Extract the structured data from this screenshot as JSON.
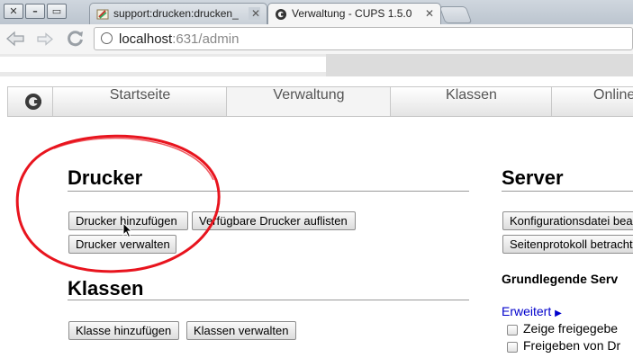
{
  "browser": {
    "tabs": [
      {
        "title": "support:drucken:drucken_",
        "active": false,
        "icon": "wiki-favicon-icon"
      },
      {
        "title": "Verwaltung - CUPS 1.5.0",
        "active": true,
        "icon": "cups-favicon-icon"
      }
    ],
    "close_glyph": "✕",
    "url_host": "localhost",
    "url_rest": ":631/admin",
    "window_buttons": {
      "minimize": "–",
      "restore": "▭"
    }
  },
  "cups": {
    "nav": [
      "Startseite",
      "Verwaltung",
      "Klassen",
      "Online"
    ],
    "active_nav": "Verwaltung",
    "printers": {
      "heading": "Drucker",
      "add": "Drucker hinzufügen",
      "list_available": "Verfügbare Drucker auflisten",
      "manage": "Drucker verwalten"
    },
    "classes": {
      "heading": "Klassen",
      "add": "Klasse hinzufügen",
      "manage": "Klassen verwalten"
    },
    "server": {
      "heading": "Server",
      "edit_config": "Konfigurationsdatei bea",
      "view_page_log": "Seitenprotokoll betracht",
      "basic_settings": "Grundlegende Serv",
      "advanced_link": "Erweitert",
      "advanced_arrow": "▶",
      "options": [
        {
          "label": "Zeige freigegebe",
          "checked": false
        },
        {
          "label": "Freigeben von Dr",
          "checked": false
        }
      ]
    }
  },
  "colors": {
    "annotation_circle": "#e8141e",
    "link": "#0000cc"
  }
}
